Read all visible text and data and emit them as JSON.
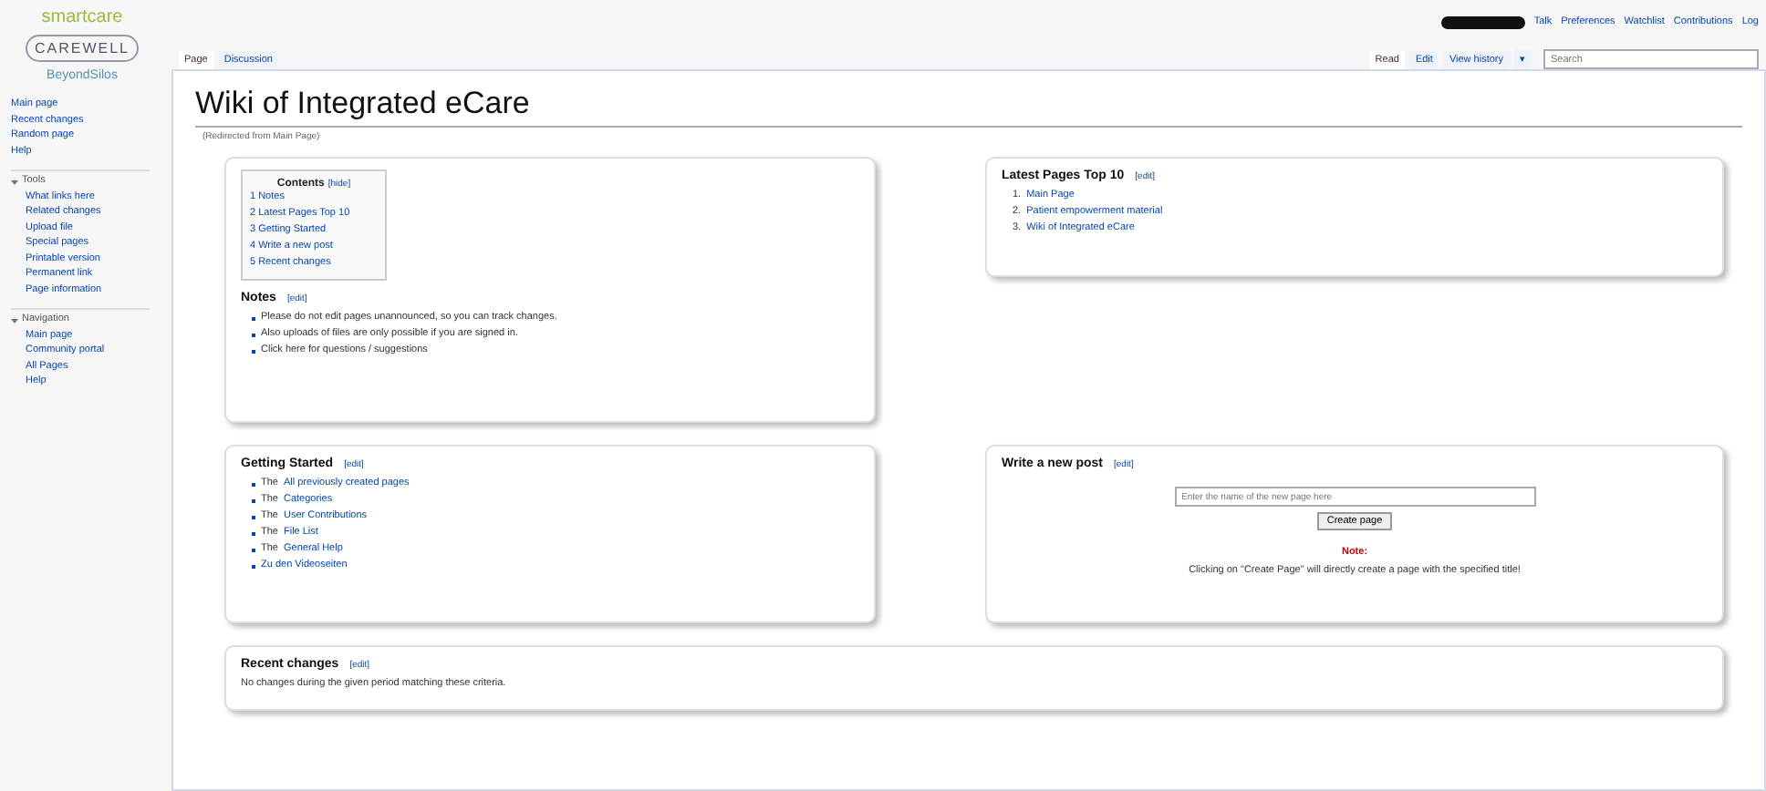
{
  "logo": {
    "lines": [
      "smartcare",
      "CAREWELL",
      "BeyondSilos"
    ]
  },
  "sidebar": {
    "items": [
      "Main page",
      "Recent changes",
      "Random page",
      "Help"
    ],
    "sections": [
      {
        "title": "Tools",
        "expanded": true,
        "items": [
          "What links here",
          "Related changes",
          "Upload file",
          "Special pages",
          "Printable version",
          "Permanent link",
          "Page information"
        ]
      },
      {
        "title": "Navigation",
        "expanded": true,
        "items": [
          "Main page",
          "Community portal",
          "All Pages",
          "Help"
        ]
      }
    ]
  },
  "personal_links": [
    "Talk",
    "Preferences",
    "Watchlist",
    "Contributions",
    "Log"
  ],
  "tabs": [
    {
      "label": "Page",
      "selected": true
    },
    {
      "label": "Discussion",
      "selected": false
    }
  ],
  "views": [
    {
      "label": "Read",
      "selected": true
    },
    {
      "label": "Edit",
      "selected": false
    },
    {
      "label": "View history",
      "selected": false
    }
  ],
  "more_menu": "▾",
  "search": {
    "placeholder": "Search"
  },
  "title": "Wiki of Integrated eCare",
  "subtitle": "(Redirected from Main Page)",
  "toc": {
    "title": "Contents",
    "toggle": "[hide]",
    "items": [
      "1 Notes",
      "2 Latest Pages Top 10",
      "3 Getting Started",
      "4 Write a new post",
      "5 Recent changes"
    ]
  },
  "notes": {
    "heading": "Notes",
    "edit": "[edit]",
    "items": [
      "Please do not edit pages unannounced, so you can track changes.",
      "Also uploads of files are only possible if you are signed in.",
      "Click here for questions / suggestions"
    ]
  },
  "latest": {
    "heading": "Latest Pages Top 10",
    "edit": "[edit]",
    "items": [
      {
        "num": "1.",
        "text": "Main Page"
      },
      {
        "num": "2.",
        "text": "Patient empowerment material"
      },
      {
        "num": "3.",
        "text": "Wiki of Integrated eCare"
      }
    ]
  },
  "getting_started": {
    "heading": "Getting Started",
    "edit": "[edit]",
    "items": [
      {
        "prefix": "The",
        "link": "All previously created pages"
      },
      {
        "prefix": "The",
        "link": "Categories"
      },
      {
        "prefix": "The",
        "link": "User Contributions"
      },
      {
        "prefix": "The",
        "link": "File List"
      },
      {
        "prefix": "The",
        "link": "General Help"
      },
      {
        "link": "Zu den Videoseiten"
      }
    ]
  },
  "new_post": {
    "heading": "Write a new post",
    "edit": "[edit]",
    "placeholder": "Enter the name of the new page here",
    "button": "Create page",
    "note_label": "Note:",
    "note": "Clicking on \"Create Page\" will directly create a page with the specified title!"
  },
  "recent": {
    "heading": "Recent changes",
    "edit": "[edit]",
    "text": "No changes during the given period matching these criteria."
  }
}
